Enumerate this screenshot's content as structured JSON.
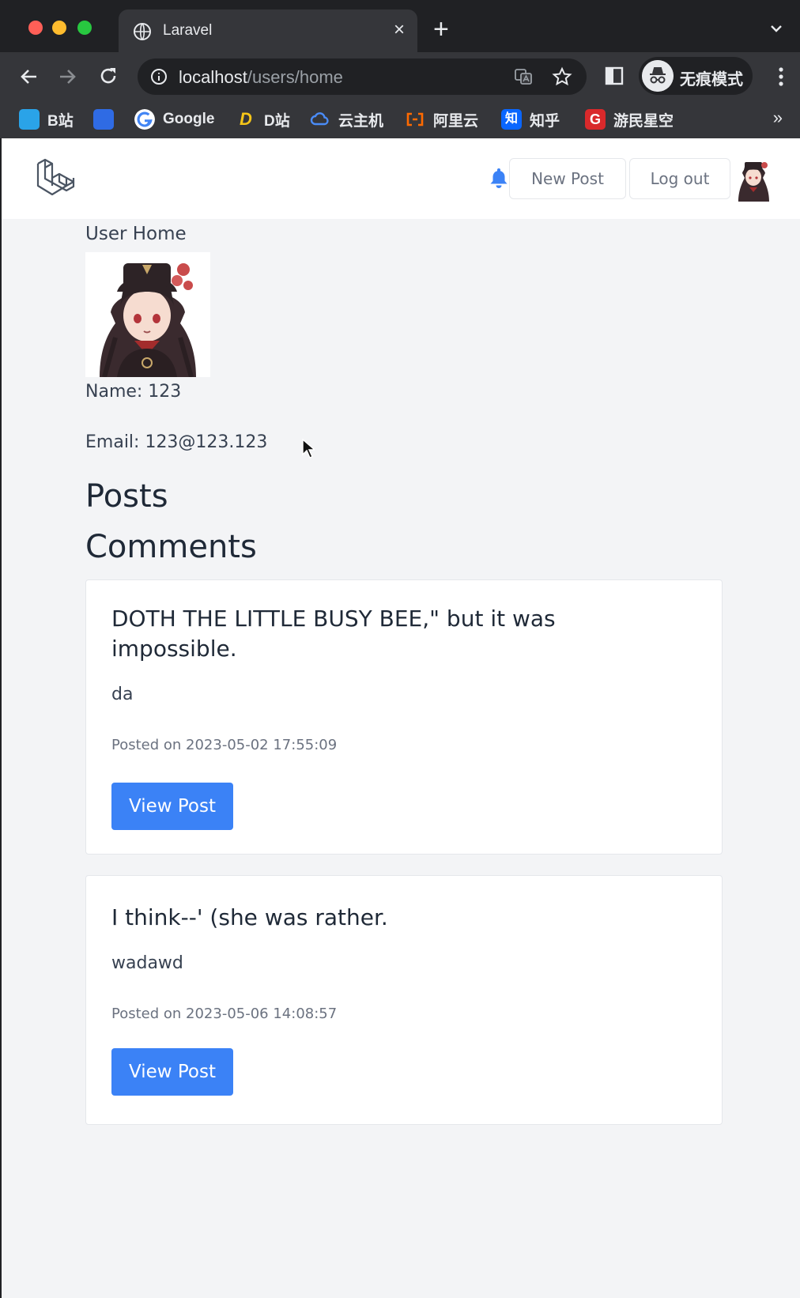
{
  "browser": {
    "tab_title": "Laravel",
    "tab_close": "×",
    "new_tab": "+",
    "url_host": "localhost",
    "url_path": "/users/home",
    "incognito_label": "无痕模式",
    "bookmarks": [
      {
        "label": "B站",
        "icon": "bilibili-icon",
        "color": "#2aa3e8"
      },
      {
        "label": "",
        "icon": "baidu-icon",
        "color": "#2f6be4"
      },
      {
        "label": "Google",
        "icon": "google-icon",
        "color": "#ffffff"
      },
      {
        "label": "D站",
        "icon": "dstation-icon",
        "color": "#f5c518"
      },
      {
        "label": "云主机",
        "icon": "cloud-icon",
        "color": "#4a8cf7"
      },
      {
        "label": "阿里云",
        "icon": "aliyun-icon",
        "color": "#ff6a00"
      },
      {
        "label": "知乎",
        "icon": "zhihu-icon",
        "color": "#0a66ff"
      },
      {
        "label": "游民星空",
        "icon": "gamersky-icon",
        "color": "#d9292b"
      }
    ],
    "bookmarks_more": "»"
  },
  "nav": {
    "new_post": "New Post",
    "log_out": "Log out"
  },
  "page": {
    "heading": "User Home",
    "name": "Name: 123",
    "email": "Email: 123@123.123",
    "posts_title": "Posts",
    "comments_title": "Comments"
  },
  "comments": [
    {
      "title": "DOTH THE LITTLE BUSY BEE,\" but it was impossible.",
      "body": "da",
      "posted": "Posted on 2023-05-02 17:55:09",
      "button": "View Post"
    },
    {
      "title": "I think--' (she was rather.",
      "body": "wadawd",
      "posted": "Posted on 2023-05-06 14:08:57",
      "button": "View Post"
    }
  ],
  "colors": {
    "primary_button": "#3b82f6",
    "bell": "#3b82f6",
    "page_bg": "#f3f4f6"
  }
}
